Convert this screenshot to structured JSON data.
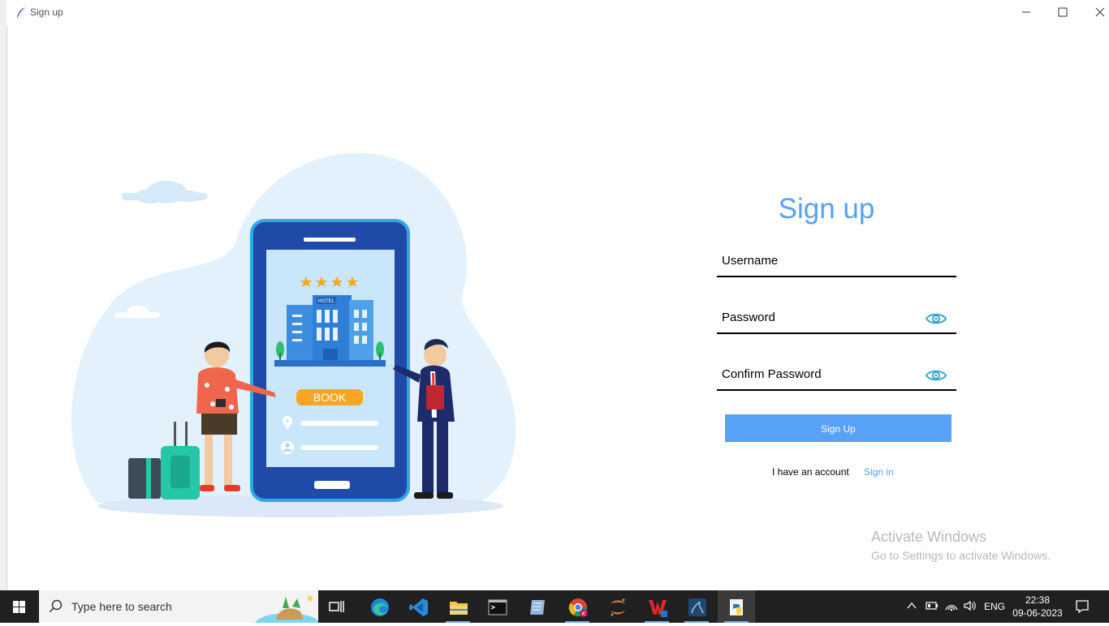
{
  "window": {
    "title": "Sign up"
  },
  "form": {
    "heading": "Sign up",
    "username_placeholder": "Username",
    "password_placeholder": "Password",
    "confirm_placeholder": "Confirm Password",
    "signup_label": "Sign Up",
    "have_account_text": "I have an account",
    "signin_label": "Sign in"
  },
  "illustration": {
    "book_label": "BOOK",
    "hotel_label": "HOTEL"
  },
  "watermark": {
    "line1": "Activate Windows",
    "line2": "Go to Settings to activate Windows."
  },
  "taskbar": {
    "search_placeholder": "Type here to search",
    "language": "ENG",
    "time": "22:38",
    "date": "09-06-2023"
  },
  "colors": {
    "accent": "#57a1f8",
    "taskbar": "#202020"
  }
}
